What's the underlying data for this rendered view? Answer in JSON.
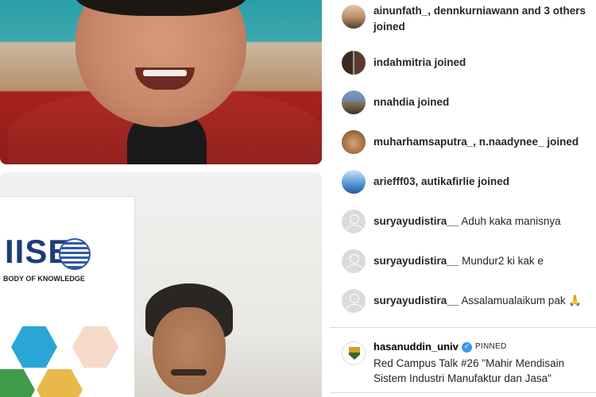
{
  "activity": [
    {
      "avatar": "av-sunset",
      "text": "ainunfath_, dennkurniawann and 3 others joined"
    },
    {
      "avatar": "av-duo",
      "text": "indahmitria joined"
    },
    {
      "avatar": "av-mountain",
      "text": "nnahdia joined"
    },
    {
      "avatar": "av-face",
      "text": "muharhamsaputra_, n.naadynee_ joined"
    },
    {
      "avatar": "av-blue",
      "text": "ariefff03, autikafirlie joined"
    }
  ],
  "comments": [
    {
      "user": "suryayudistira__",
      "text": "Aduh kaka manisnya"
    },
    {
      "user": "suryayudistira__",
      "text": "Mundur2 ki kak e"
    },
    {
      "user": "suryayudistira__",
      "text": "Assalamualaikum pak 🙏"
    }
  ],
  "pinned": {
    "user": "hasanuddin_univ",
    "label": "PINNED",
    "message": "Red Campus Talk #26 \"Mahir Mendisain Sistem Industri Manufaktur dan Jasa\""
  },
  "banner": {
    "logo_text": "IISE",
    "subtitle": "BODY OF KNOWLEDGE"
  },
  "colors": {
    "verified": "#3897f0",
    "text": "#262626"
  }
}
